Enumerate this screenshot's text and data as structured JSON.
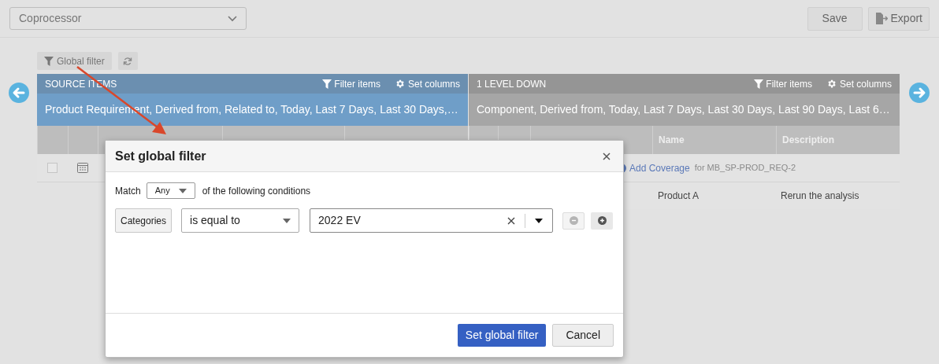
{
  "project_select": {
    "value": "Coprocessor"
  },
  "actions": [
    {
      "kind": "save",
      "label": "Save"
    },
    {
      "kind": "export",
      "label": "Export"
    }
  ],
  "toolbar": {
    "global_filter": "Global filter"
  },
  "panels": [
    {
      "kind": "source",
      "title": "SOURCE ITEMS",
      "filter": "Filter items",
      "columns_button": "Set columns",
      "summary": "Product Requirement, Derived from, Related to, Today, Last 7 Days, Last 30 Days,…",
      "rows": [
        {
          "kind": "item",
          "checked": false
        }
      ]
    },
    {
      "kind": "target",
      "title": "1 LEVEL DOWN",
      "filter": "Filter items",
      "columns_button": "Set columns",
      "summary": "Component, Derived from, Today, Last 7 Days, Last 30 Days, Last 90 Days, Last 6…",
      "headers": [
        "Name",
        "Description"
      ],
      "rows": [
        {
          "kind": "coverage",
          "link": "Add Coverage",
          "note": "for MB_SP-PROD_REQ-2"
        },
        {
          "kind": "values",
          "name": "Product A",
          "description": "Rerun the analysis"
        }
      ]
    }
  ],
  "dialog": {
    "title": "Set global filter",
    "match_label": "Match",
    "match_value": "Any",
    "match_suffix": "of the following conditions",
    "conditions": [
      {
        "field": "Categories",
        "operator": "is equal to",
        "value": "2022 EV",
        "remove_disabled": true
      }
    ],
    "primary": "Set global filter",
    "cancel": "Cancel"
  }
}
